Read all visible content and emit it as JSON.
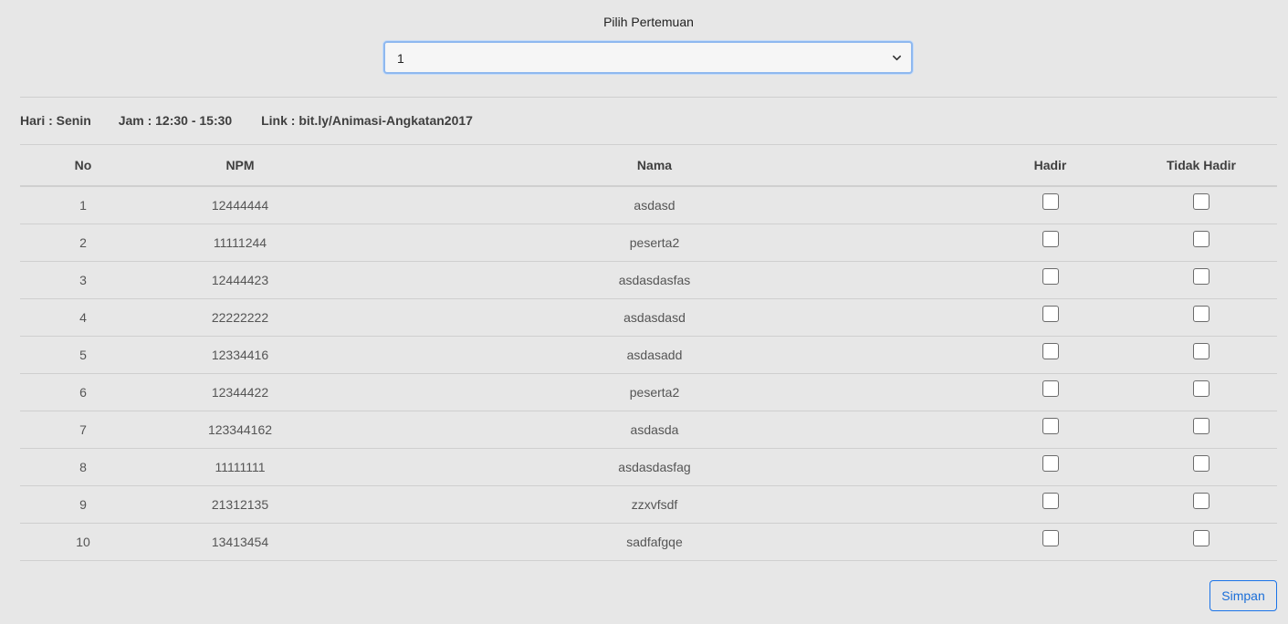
{
  "meeting_select": {
    "label": "Pilih Pertemuan",
    "selected_value": "1"
  },
  "info": {
    "hari": "Hari : Senin",
    "jam": "Jam : 12:30 - 15:30",
    "link": "Link : bit.ly/Animasi-Angkatan2017"
  },
  "table": {
    "headers": {
      "no": "No",
      "npm": "NPM",
      "nama": "Nama",
      "hadir": "Hadir",
      "tidak_hadir": "Tidak Hadir"
    },
    "rows": [
      {
        "no": "1",
        "npm": "12444444",
        "nama": "asdasd",
        "hadir": false,
        "tidak_hadir": false
      },
      {
        "no": "2",
        "npm": "11111244",
        "nama": "peserta2",
        "hadir": false,
        "tidak_hadir": false
      },
      {
        "no": "3",
        "npm": "12444423",
        "nama": "asdasdasfas",
        "hadir": false,
        "tidak_hadir": false
      },
      {
        "no": "4",
        "npm": "22222222",
        "nama": "asdasdasd",
        "hadir": false,
        "tidak_hadir": false
      },
      {
        "no": "5",
        "npm": "12334416",
        "nama": "asdasadd",
        "hadir": false,
        "tidak_hadir": false
      },
      {
        "no": "6",
        "npm": "12344422",
        "nama": "peserta2",
        "hadir": false,
        "tidak_hadir": false
      },
      {
        "no": "7",
        "npm": "123344162",
        "nama": "asdasda",
        "hadir": false,
        "tidak_hadir": false
      },
      {
        "no": "8",
        "npm": "11111111",
        "nama": "asdasdasfag",
        "hadir": false,
        "tidak_hadir": false
      },
      {
        "no": "9",
        "npm": "21312135",
        "nama": "zzxvfsdf",
        "hadir": false,
        "tidak_hadir": false
      },
      {
        "no": "10",
        "npm": "13413454",
        "nama": "sadfafgqe",
        "hadir": false,
        "tidak_hadir": false
      }
    ]
  },
  "save_button": {
    "label": "Simpan"
  },
  "icons": {
    "select": "chevron-down-icon"
  },
  "colors": {
    "background": "#e7e7e7",
    "accent": "#1a73e8",
    "select_focus_border": "#8eb8ef"
  }
}
